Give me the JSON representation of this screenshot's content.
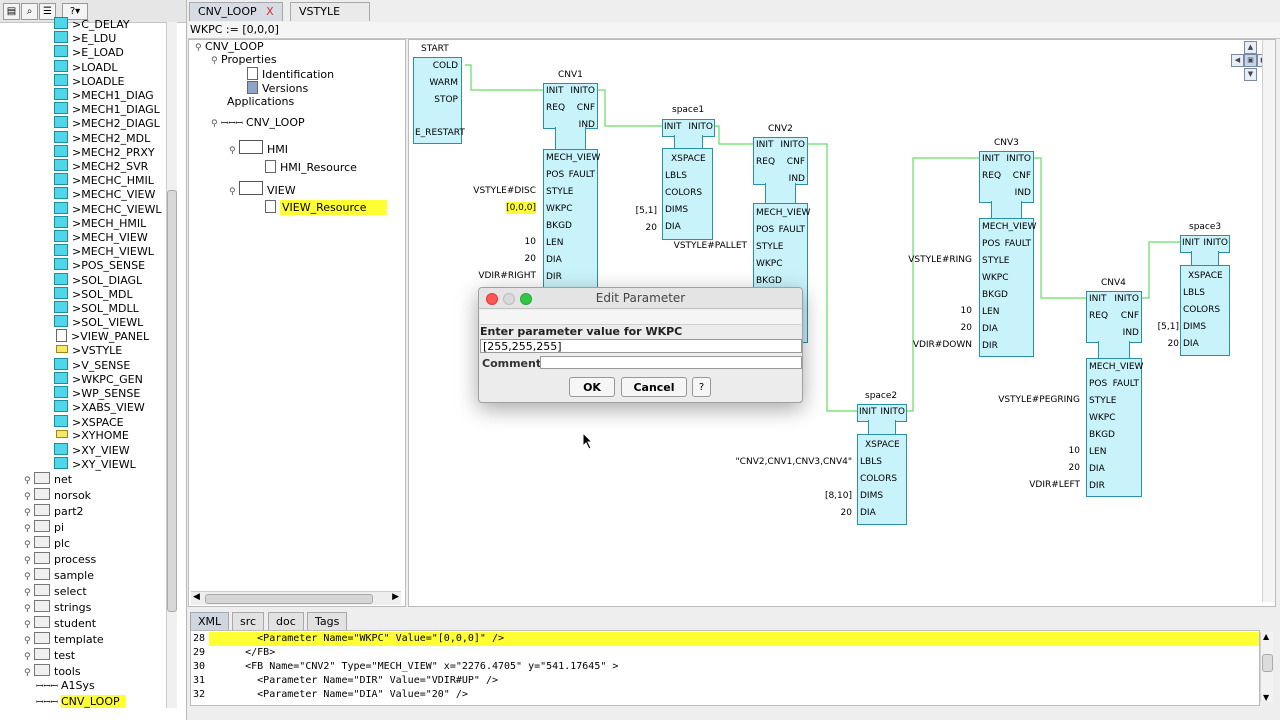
{
  "left_toolbar": {
    "help_label": "?"
  },
  "library": {
    "items": [
      {
        "label": ">C_DELAY",
        "icon": "fb"
      },
      {
        "label": ">E_LDU",
        "icon": "fb"
      },
      {
        "label": ">E_LOAD",
        "icon": "fb"
      },
      {
        "label": ">LOADL",
        "icon": "fb"
      },
      {
        "label": ">LOADLE",
        "icon": "fb"
      },
      {
        "label": ">MECH1_DIAG",
        "icon": "fb"
      },
      {
        "label": ">MECH1_DIAGL",
        "icon": "fb"
      },
      {
        "label": ">MECH2_DIAGL",
        "icon": "fb"
      },
      {
        "label": ">MECH2_MDL",
        "icon": "fb"
      },
      {
        "label": ">MECH2_PRXY",
        "icon": "fb"
      },
      {
        "label": ">MECH2_SVR",
        "icon": "fb"
      },
      {
        "label": ">MECHC_HMIL",
        "icon": "fb"
      },
      {
        "label": ">MECHC_VIEW",
        "icon": "fb"
      },
      {
        "label": ">MECHC_VIEWL",
        "icon": "fb"
      },
      {
        "label": ">MECH_HMIL",
        "icon": "fb"
      },
      {
        "label": ">MECH_VIEW",
        "icon": "fb"
      },
      {
        "label": ">MECH_VIEWL",
        "icon": "fb"
      },
      {
        "label": ">POS_SENSE",
        "icon": "fb"
      },
      {
        "label": ">SOL_DIAGL",
        "icon": "fb"
      },
      {
        "label": ">SOL_MDL",
        "icon": "fb"
      },
      {
        "label": ">SOL_MDLL",
        "icon": "fb"
      },
      {
        "label": ">SOL_VIEWL",
        "icon": "fb"
      },
      {
        "label": ">VIEW_PANEL",
        "icon": "sub"
      },
      {
        "label": ">VSTYLE",
        "icon": "dt"
      },
      {
        "label": ">V_SENSE",
        "icon": "fb"
      },
      {
        "label": ">WKPC_GEN",
        "icon": "fb"
      },
      {
        "label": ">WP_SENSE",
        "icon": "fb"
      },
      {
        "label": ">XABS_VIEW",
        "icon": "fb"
      },
      {
        "label": ">XSPACE",
        "icon": "fb"
      },
      {
        "label": ">XYHOME",
        "icon": "dt"
      },
      {
        "label": ">XY_VIEW",
        "icon": "fb"
      },
      {
        "label": ">XY_VIEWL",
        "icon": "fb"
      }
    ],
    "folders": [
      "net",
      "norsok",
      "part2",
      "pi",
      "plc",
      "process",
      "sample",
      "select",
      "strings",
      "student",
      "template",
      "test",
      "tools"
    ],
    "systems": [
      "A1Sys",
      "CNV_LOOP"
    ]
  },
  "tabs": [
    {
      "label": "CNV_LOOP",
      "close": "X"
    },
    {
      "label": "VSTYLE"
    }
  ],
  "wkpc_bar": "WKPC := [0,0,0]",
  "tree": {
    "root": "CNV_LOOP",
    "properties": "Properties",
    "identification": "Identification",
    "versions": "Versions",
    "applications": "Applications",
    "app": "CNV_LOOP",
    "hmi": "HMI",
    "hmi_resource": "HMI_Resource",
    "view": "VIEW",
    "view_resource": "VIEW_Resource"
  },
  "diagram": {
    "start": {
      "title": "START",
      "pins": [
        "COLD",
        "WARM",
        "STOP",
        "E_RESTART"
      ]
    },
    "cnv1": {
      "title": "CNV1",
      "events": [
        "INIT",
        "INITO",
        "REQ",
        "CNF",
        "IND"
      ],
      "type": "MECH_VIEW",
      "data": [
        "POS",
        "FAULT",
        "STYLE",
        "WKPC",
        "BKGD",
        "LEN",
        "DIA",
        "DIR"
      ],
      "params": {
        "style": "VSTYLE#DISC",
        "wkpc": "[0,0,0]",
        "len": "10",
        "dia": "20",
        "dir": "VDIR#RIGHT"
      }
    },
    "space1": {
      "title": "space1",
      "events": [
        "INIT",
        "INITO"
      ],
      "type": "XSPACE",
      "data": [
        "LBLS",
        "COLORS",
        "DIMS",
        "DIA"
      ],
      "params": {
        "dims": "[5,1]",
        "dia": "20"
      }
    },
    "cnv2": {
      "title": "CNV2",
      "events": [
        "INIT",
        "INITO",
        "REQ",
        "CNF",
        "IND"
      ],
      "type": "MECH_VIEW",
      "data": [
        "POS",
        "FAULT",
        "STYLE",
        "WKPC",
        "BKGD"
      ],
      "params": {
        "style": "VSTYLE#PALLET"
      }
    },
    "cnv3": {
      "title": "CNV3",
      "events": [
        "INIT",
        "INITO",
        "REQ",
        "CNF",
        "IND"
      ],
      "type": "MECH_VIEW",
      "data": [
        "POS",
        "FAULT",
        "STYLE",
        "WKPC",
        "BKGD",
        "LEN",
        "DIA",
        "DIR"
      ],
      "params": {
        "style": "VSTYLE#RING",
        "len": "10",
        "dia": "20",
        "dir": "VDIR#DOWN"
      }
    },
    "space2": {
      "title": "space2",
      "events": [
        "INIT",
        "INITO"
      ],
      "type": "XSPACE",
      "data": [
        "LBLS",
        "COLORS",
        "DIMS",
        "DIA"
      ],
      "params": {
        "lbls": "\"CNV2,CNV1,CNV3,CNV4\"",
        "dims": "[8,10]",
        "dia": "20"
      }
    },
    "cnv4": {
      "title": "CNV4",
      "events": [
        "INIT",
        "INITO",
        "REQ",
        "CNF",
        "IND"
      ],
      "type": "MECH_VIEW",
      "data": [
        "POS",
        "FAULT",
        "STYLE",
        "WKPC",
        "BKGD",
        "LEN",
        "DIA",
        "DIR"
      ],
      "params": {
        "style": "VSTYLE#PEGRING",
        "len": "10",
        "dia": "20",
        "dir": "VDIR#LEFT"
      }
    },
    "space3": {
      "title": "space3",
      "events": [
        "INIT",
        "INITO"
      ],
      "type": "XSPACE",
      "data": [
        "LBLS",
        "COLORS",
        "DIMS",
        "DIA"
      ],
      "params": {
        "dims": "[5,1]",
        "dia": "20"
      }
    }
  },
  "dialog": {
    "title": "Edit Parameter",
    "prompt": "Enter parameter value for WKPC",
    "value": "[255,255,255]",
    "comment_label": "Comment",
    "comment_value": "",
    "ok": "OK",
    "cancel": "Cancel",
    "help": "?"
  },
  "bottom_tabs": [
    "XML",
    "src",
    "doc",
    "Tags"
  ],
  "xml_lines": [
    {
      "num": "28",
      "text": "        <Parameter Name=\"WKPC\" Value=\"[0,0,0]\" />",
      "highlight": true
    },
    {
      "num": "29",
      "text": "      </FB>",
      "highlight": false
    },
    {
      "num": "30",
      "text": "      <FB Name=\"CNV2\" Type=\"MECH_VIEW\" x=\"2276.4705\" y=\"541.17645\" >",
      "highlight": false
    },
    {
      "num": "31",
      "text": "        <Parameter Name=\"DIR\" Value=\"VDIR#UP\" />",
      "highlight": false
    },
    {
      "num": "32",
      "text": "        <Parameter Name=\"DIA\" Value=\"20\" />",
      "highlight": false
    }
  ],
  "colors": {
    "highlight": "#ffff33",
    "fb_fill": "#c9f3fb",
    "fb_border": "#2b8fa8",
    "connection": "#66dd66"
  }
}
